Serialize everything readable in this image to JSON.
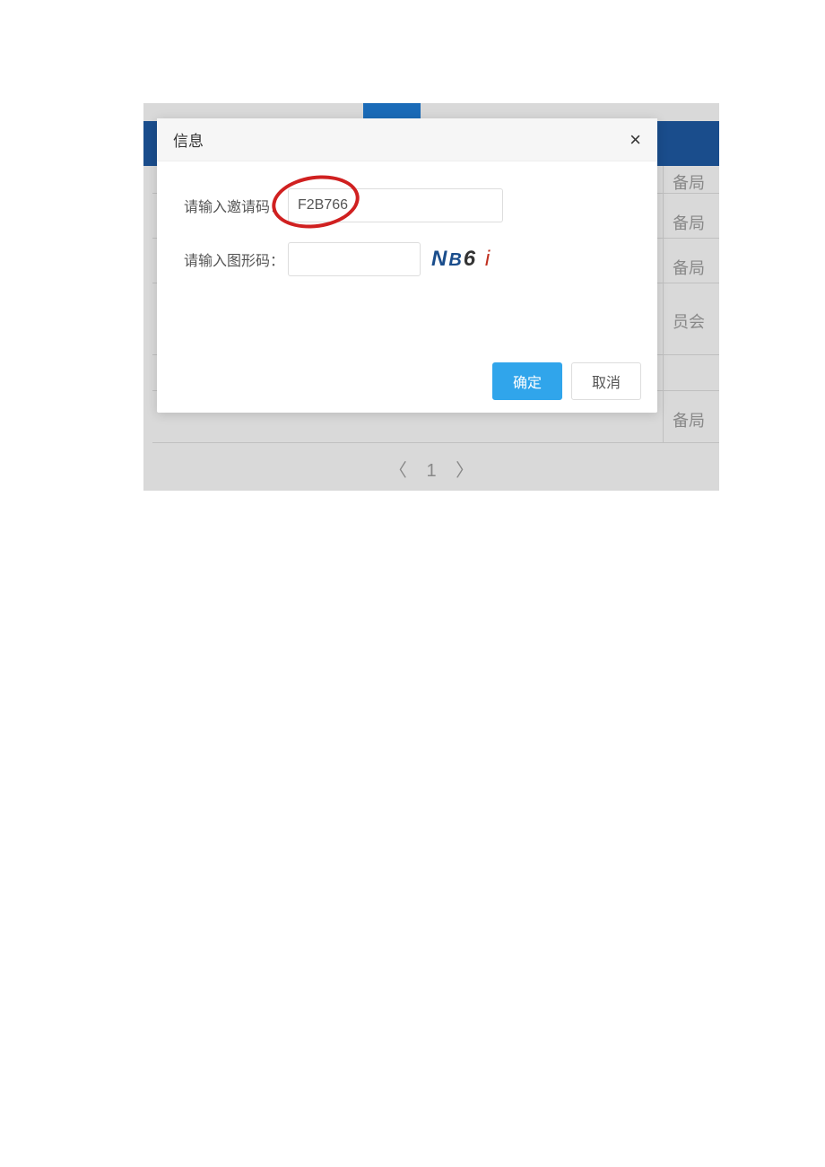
{
  "modal": {
    "title": "信息",
    "invite_label": "请输入邀请码：",
    "invite_value": "F2B766",
    "captcha_label": "请输入图形码：",
    "captcha_value": "",
    "captcha_text": {
      "c1": "N",
      "c2": "B",
      "c3": "6",
      "c4": "i"
    },
    "confirm": "确定",
    "cancel": "取消",
    "close": "×"
  },
  "background": {
    "rows": [
      "备局",
      "备局",
      "备局",
      "员会",
      "备局"
    ]
  },
  "pagination": {
    "prev": "〈",
    "page": "1",
    "next": "〉"
  }
}
